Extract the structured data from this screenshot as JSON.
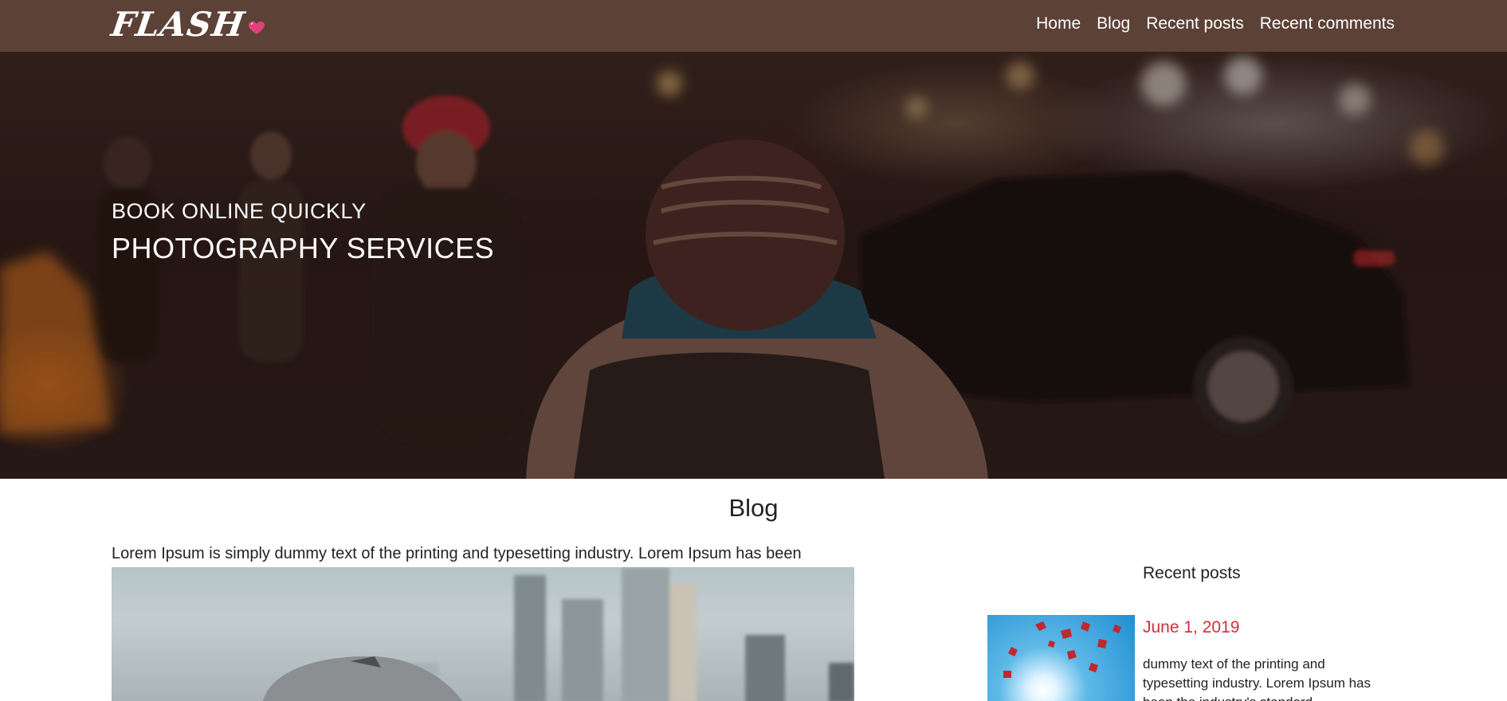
{
  "header": {
    "logo_text": "FLASH",
    "logo_icon": "heart-icon",
    "background_color": "#5c4137",
    "nav": [
      {
        "label": "Home"
      },
      {
        "label": "Blog"
      },
      {
        "label": "Recent posts"
      },
      {
        "label": "Recent comments"
      }
    ]
  },
  "hero": {
    "subtitle": "BOOK ONLINE QUICKLY",
    "title": "PHOTOGRAPHY SERVICES"
  },
  "main": {
    "section_title": "Blog",
    "post": {
      "excerpt": "Lorem Ipsum is simply dummy text of the printing and typesetting industry. Lorem Ipsum has been"
    }
  },
  "sidebar": {
    "title": "Recent posts",
    "posts": [
      {
        "date": "June 1, 2019",
        "text": "dummy text of the printing and typesetting industry. Lorem Ipsum has been the industry's standard"
      }
    ]
  },
  "colors": {
    "accent": "#d0303a",
    "heart": "#e0417a"
  }
}
